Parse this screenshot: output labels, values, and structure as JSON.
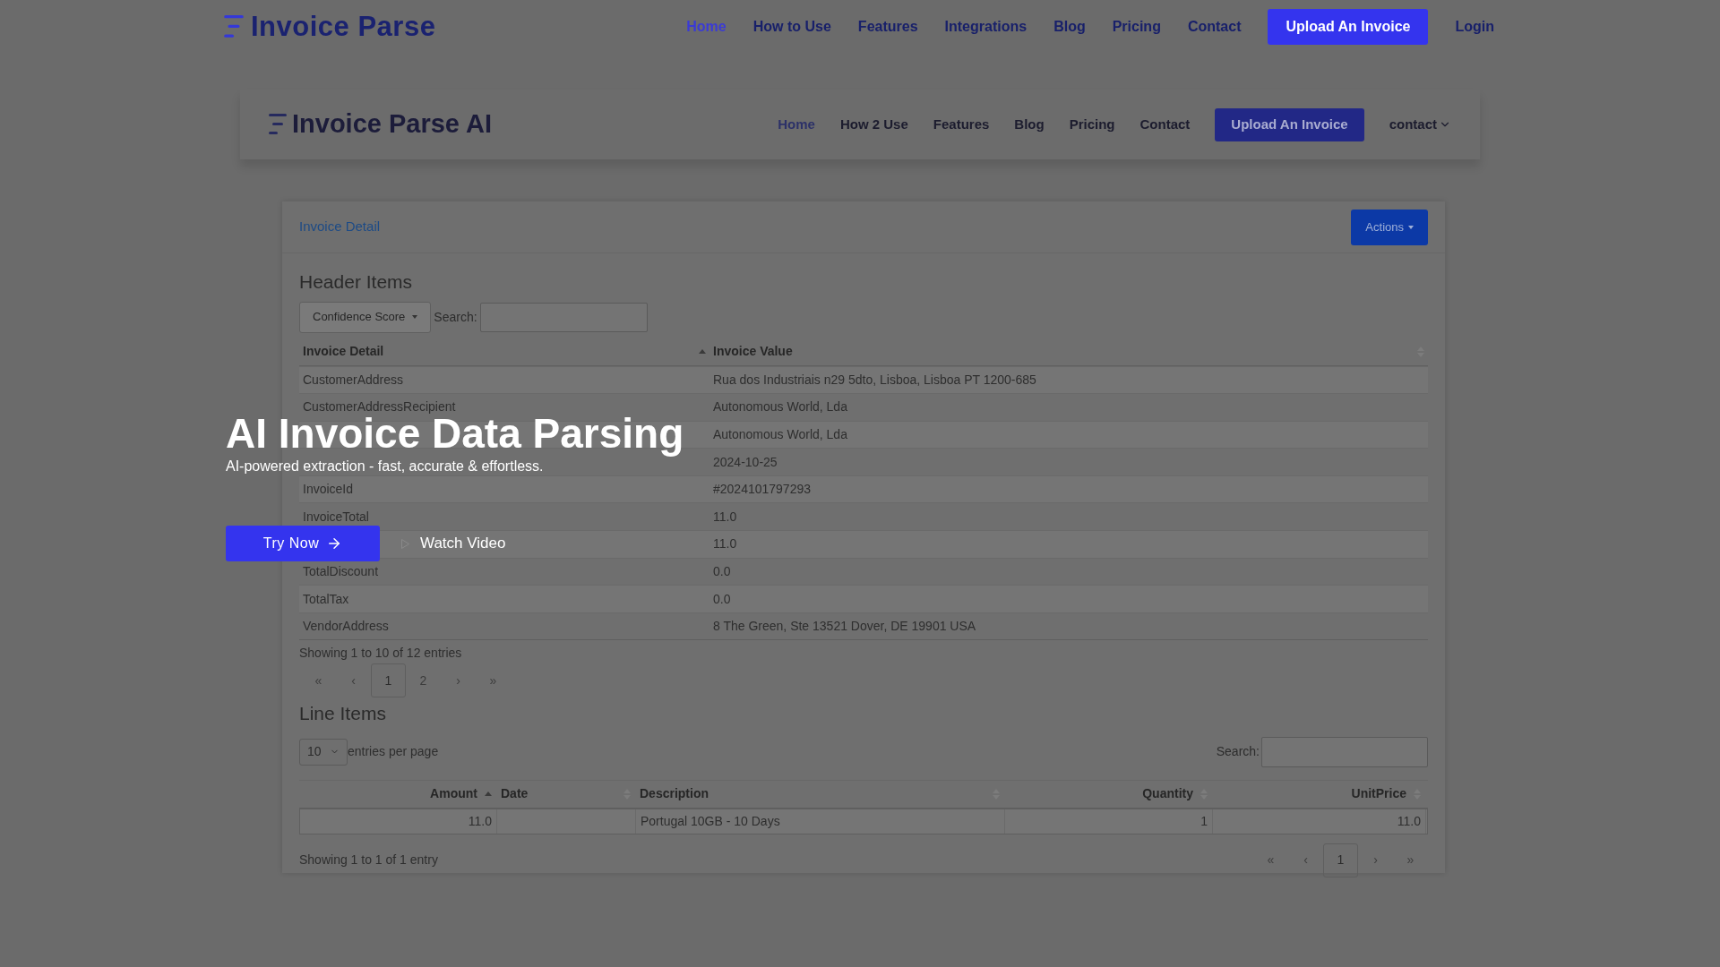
{
  "nav": {
    "logo": "Invoice Parse",
    "links": [
      {
        "label": "Home",
        "selected": true
      },
      {
        "label": "How to Use",
        "selected": false
      },
      {
        "label": "Features",
        "selected": false
      },
      {
        "label": "Integrations",
        "selected": false
      },
      {
        "label": "Blog",
        "selected": false
      },
      {
        "label": "Pricing",
        "selected": false
      },
      {
        "label": "Contact",
        "selected": false
      }
    ],
    "cta": "Upload An Invoice",
    "login": "Login"
  },
  "app_preview": {
    "logo": "Invoice Parse AI",
    "links": [
      {
        "label": "Home",
        "selected": true
      },
      {
        "label": "How 2 Use",
        "selected": false
      },
      {
        "label": "Features",
        "selected": false
      },
      {
        "label": "Blog",
        "selected": false
      },
      {
        "label": "Pricing",
        "selected": false
      },
      {
        "label": "Contact",
        "selected": false
      }
    ],
    "cta": "Upload An Invoice",
    "menu": "contact",
    "card_title": "Invoice Detail",
    "actions": "Actions",
    "header_items": {
      "title": "Header Items",
      "filter": "Confidence Score",
      "search_label": "Search:",
      "columns": [
        {
          "label": "Invoice Detail",
          "sorted": true
        },
        {
          "label": "Invoice Value",
          "sorted": false
        }
      ],
      "rows": [
        {
          "detail": "CustomerAddress",
          "value": "Rua dos Industriais n29 5dto, Lisboa, Lisboa PT 1200-685"
        },
        {
          "detail": "CustomerAddressRecipient",
          "value": "Autonomous World, Lda"
        },
        {
          "value": "Autonomous World, Lda"
        },
        {
          "value": "2024-10-25"
        },
        {
          "detail": "InvoiceId",
          "value": "#2024101797293"
        },
        {
          "detail": "InvoiceTotal",
          "value": "11.0"
        },
        {
          "value": "11.0"
        },
        {
          "detail": "TotalDiscount",
          "value": "0.0"
        },
        {
          "detail": "TotalTax",
          "value": "0.0"
        },
        {
          "detail": "VendorAddress",
          "value": "8 The Green, Ste 13521 Dover, DE 19901 USA"
        }
      ],
      "info": "Showing 1 to 10 of 12 entries",
      "pages": [
        {
          "label": "«",
          "selected": false
        },
        {
          "label": "‹",
          "selected": false
        },
        {
          "label": "1",
          "selected": true
        },
        {
          "label": "2",
          "selected": false
        },
        {
          "label": "›",
          "selected": false
        },
        {
          "label": "»",
          "selected": false
        }
      ]
    },
    "line_items": {
      "title": "Line Items",
      "page_size": "10",
      "page_size_label": "entries per page",
      "search_label": "Search:",
      "columns": [
        {
          "label": "Amount",
          "sorted": true
        },
        {
          "label": "Date",
          "sorted": false
        },
        {
          "label": "Description",
          "sorted": false
        },
        {
          "label": "Quantity",
          "sorted": false
        },
        {
          "label": "UnitPrice",
          "sorted": false
        }
      ],
      "rows": [
        [
          "11.0",
          null,
          "Portugal 10GB - 10 Days",
          "1",
          "11.0"
        ]
      ],
      "info": "Showing 1 to 1 of 1 entry",
      "pages": [
        {
          "label": "«",
          "selected": false
        },
        {
          "label": "‹",
          "selected": false
        },
        {
          "label": "1",
          "selected": true
        },
        {
          "label": "›",
          "selected": false
        },
        {
          "label": "»",
          "selected": false
        }
      ]
    }
  },
  "hero": {
    "title": "AI Invoice Data Parsing",
    "subtitle": "AI-powered extraction - fast, accurate & effortless.",
    "primary": "Try Now",
    "secondary": "Watch Video"
  }
}
